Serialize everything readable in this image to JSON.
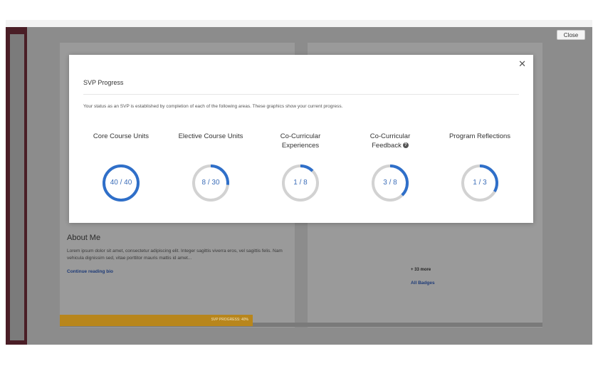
{
  "overlay": {
    "close_label": "Close"
  },
  "background": {
    "about_title": "About Me",
    "about_text": "Lorem ipsum dolor sit amet, consectetur adipiscing elit. Integer sagittis viverra eros, vel sagittis felis. Nam vehicula dignissim sed, vitae porttitor mauris mattis id amet...",
    "continue_link": "Continue reading bio",
    "more_badges": "+ 33 more",
    "all_badges_link": "All Badges",
    "progress_label": "SVP PROGRESS: 40%",
    "progress_fraction": 0.4
  },
  "modal": {
    "title": "SVP Progress",
    "description": "Your status as an SVP is established by completion of each of the following areas. These graphics show your current progress.",
    "close_glyph": "✕",
    "help_glyph": "?",
    "ring_color": "#2f6fc9",
    "track_color": "#d2d2d2",
    "items": [
      {
        "label_line1": "Core Course Units",
        "label_line2": "",
        "value": "40 / 40",
        "done": 40,
        "total": 40,
        "help": false
      },
      {
        "label_line1": "Elective Course Units",
        "label_line2": "",
        "value": "8 / 30",
        "done": 8,
        "total": 30,
        "help": false
      },
      {
        "label_line1": "Co-Curricular",
        "label_line2": "Experiences",
        "value": "1 / 8",
        "done": 1,
        "total": 8,
        "help": false
      },
      {
        "label_line1": "Co-Curricular",
        "label_line2": "Feedback",
        "value": "3 / 8",
        "done": 3,
        "total": 8,
        "help": true
      },
      {
        "label_line1": "Program Reflections",
        "label_line2": "",
        "value": "1 / 3",
        "done": 1,
        "total": 3,
        "help": false
      }
    ]
  }
}
